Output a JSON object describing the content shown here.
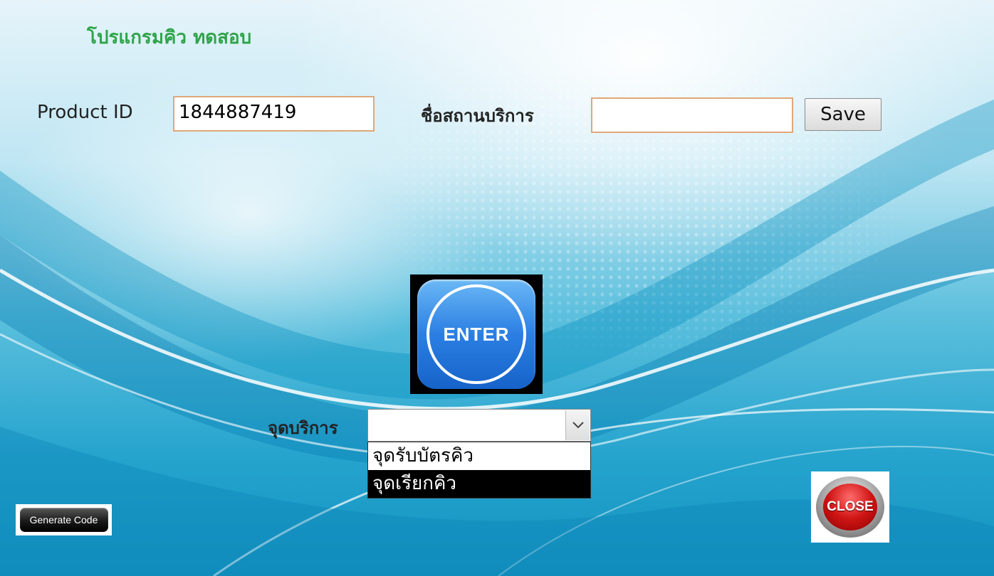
{
  "window": {
    "title": "โปรแกรมคิว ทดสอบ"
  },
  "form": {
    "product_id_label": "Product ID",
    "product_id_value": "1844887419",
    "service_name_label": "ชื่อสถานบริการ",
    "service_name_value": "",
    "save_label": "Save"
  },
  "enter_button": {
    "label": "ENTER"
  },
  "service_point": {
    "label": "จุดบริการ",
    "selected": "",
    "options": [
      "จุดรับบัตรคิว",
      "จุดเรียกคิว"
    ],
    "highlighted_index": 1
  },
  "buttons": {
    "generate_code": "Generate Code",
    "close": "CLOSE"
  },
  "colors": {
    "title": "#2fa44a",
    "field_border": "#e0a77a",
    "enter_blue": "#2b7fe3",
    "close_red": "#d01515"
  }
}
